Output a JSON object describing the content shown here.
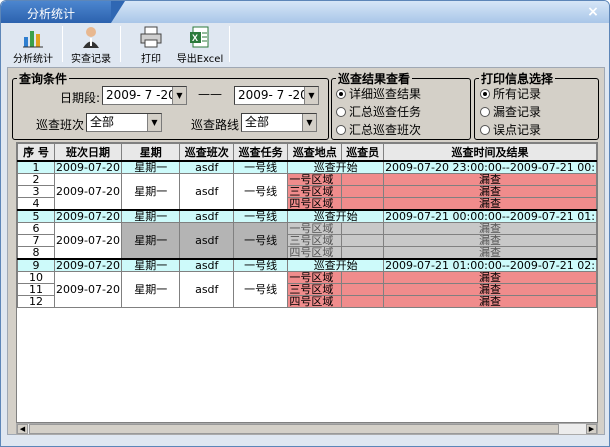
{
  "window": {
    "title": "分析统计",
    "close_glyph": "×"
  },
  "toolbar": {
    "buttons": [
      {
        "label": "分析统计",
        "icon": "chart-icon"
      },
      {
        "label": "实查记录",
        "icon": "person-icon"
      },
      {
        "label": "打印",
        "icon": "printer-icon"
      },
      {
        "label": "导出Excel",
        "icon": "excel-icon"
      }
    ]
  },
  "query": {
    "legend": "查询条件",
    "date_label": "日期段:",
    "date_from": "2009- 7 -20",
    "date_to": "2009- 7 -20",
    "dash": "——",
    "shift_label": "巡查班次",
    "shift_value": "全部",
    "route_label": "巡查路线",
    "route_value": "全部"
  },
  "view": {
    "legend": "巡查结果查看",
    "options": [
      "详细巡查结果",
      "汇总巡查任务",
      "汇总巡查班次"
    ],
    "selected": 0
  },
  "print": {
    "legend": "打印信息选择",
    "options": [
      "所有记录",
      "漏查记录",
      "误点记录"
    ],
    "selected": 0
  },
  "table": {
    "headers": [
      "序 号",
      "班次日期",
      "星期",
      "巡查班次",
      "巡查任务",
      "巡查地点",
      "巡查员",
      "巡查时间及结果"
    ],
    "groups": [
      {
        "style": "red",
        "date": "2009-07-20",
        "weekday": "星期一",
        "shift": "asdf",
        "task": "一号线",
        "start": {
          "no": "1",
          "location": "巡查开始",
          "result": "2009-07-20 23:00:00--2009-07-21 00:"
        },
        "rows": [
          {
            "no": "2",
            "location": "一号区域",
            "result": "漏查"
          },
          {
            "no": "3",
            "location": "三号区域",
            "result": "漏查"
          },
          {
            "no": "4",
            "location": "四号区域",
            "result": "漏查"
          }
        ]
      },
      {
        "style": "gray",
        "date": "2009-07-20",
        "weekday": "星期一",
        "shift": "asdf",
        "task": "一号线",
        "start": {
          "no": "5",
          "location": "巡查开始",
          "result": "2009-07-21 00:00:00--2009-07-21 01:"
        },
        "rows": [
          {
            "no": "6",
            "location": "一号区域",
            "result": "漏查"
          },
          {
            "no": "7",
            "location": "三号区域",
            "result": "漏查"
          },
          {
            "no": "8",
            "location": "四号区域",
            "result": "漏查"
          }
        ]
      },
      {
        "style": "red",
        "date": "2009-07-20",
        "weekday": "星期一",
        "shift": "asdf",
        "task": "一号线",
        "start": {
          "no": "9",
          "location": "巡查开始",
          "result": "2009-07-21 01:00:00--2009-07-21 02:"
        },
        "rows": [
          {
            "no": "10",
            "location": "一号区域",
            "result": "漏查"
          },
          {
            "no": "11",
            "location": "三号区域",
            "result": "漏查"
          },
          {
            "no": "12",
            "location": "四号区域",
            "result": "漏查"
          }
        ]
      }
    ]
  }
}
